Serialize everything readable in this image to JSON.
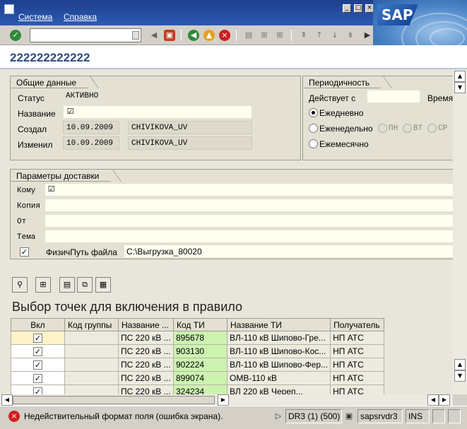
{
  "menu": {
    "items": [
      "Система",
      "Справка"
    ]
  },
  "logo": "SAP",
  "title": "222222222222",
  "general": {
    "title": "Общие данные",
    "status_label": "Статус",
    "status_value": "АКТИВНО",
    "name_label": "Название",
    "created_label": "Создал",
    "created_date": "10.09.2009",
    "created_user": "CHIVIKOVA_UV",
    "changed_label": "Изменил",
    "changed_date": "10.09.2009",
    "changed_user": "CHIVIKOVA_UV"
  },
  "periodicity": {
    "title": "Периодичность",
    "valid_from_label": "Действует с",
    "time_label": "Время",
    "daily": "Ежедневно",
    "weekly": "Еженедельно",
    "monthly": "Ежемесячно",
    "days": [
      "ПН",
      "ВТ",
      "СР"
    ],
    "selected": "daily"
  },
  "delivery": {
    "title": "Параметры доставки",
    "to_label": "Кому",
    "copy_label": "Копия",
    "from_label": "От",
    "subject_label": "Тема",
    "path_label": "ФизичПуть файла",
    "path_value": "C:\\Выгрузка_80020"
  },
  "alv": {
    "title": "Выбор точек для включения в правило",
    "columns": [
      "Вкл",
      "Код группы",
      "Название ...",
      "Код ТИ",
      "Название ТИ",
      "Получатель"
    ],
    "rows": [
      {
        "checked": true,
        "group": "",
        "name": "ПС 220 кВ ...",
        "code": "895678",
        "ti_name": "ВЛ-110 кВ Шипово-Гре...",
        "recipient": "НП АТС"
      },
      {
        "checked": true,
        "group": "",
        "name": "ПС 220 кВ ...",
        "code": "903130",
        "ti_name": "ВЛ-110 кВ Шипово-Кос...",
        "recipient": "НП АТС"
      },
      {
        "checked": true,
        "group": "",
        "name": "ПС 220 кВ ...",
        "code": "902224",
        "ti_name": "ВЛ-110 кВ Шипово-Фер...",
        "recipient": "НП АТС"
      },
      {
        "checked": true,
        "group": "",
        "name": "ПС 220 кВ ...",
        "code": "899074",
        "ti_name": "ОМВ-110 кВ",
        "recipient": "НП АТС"
      },
      {
        "checked": true,
        "group": "",
        "name": "ПС 220 кВ ...",
        "code": "324234",
        "ti_name": "ВЛ 220 кВ Череп...",
        "recipient": "НП АТС"
      }
    ]
  },
  "statusbar": {
    "message": "Недействительный формат поля (ошибка экрана).",
    "system": "DR3 (1) (500)",
    "server": "sapsrvdr3",
    "mode": "INS"
  },
  "colors": {
    "error": "#d21f1f",
    "highlight_green": "#ccf2b0",
    "title_blue": "#2d4a80"
  }
}
